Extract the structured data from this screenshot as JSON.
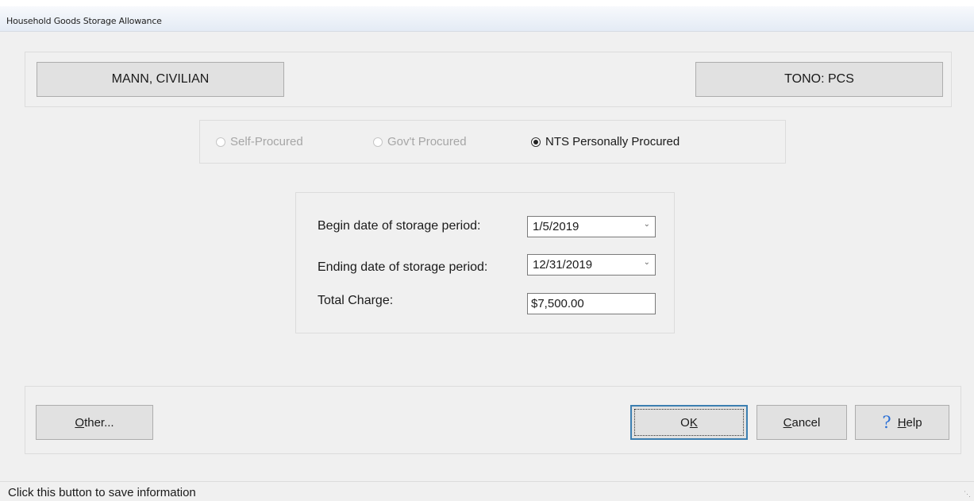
{
  "window": {
    "title": "Household Goods Storage Allowance"
  },
  "header": {
    "member_name": "MANN, CIVILIAN",
    "order_info": "TONO: PCS"
  },
  "procurement": {
    "options": [
      {
        "label": "Self-Procured",
        "selected": false,
        "enabled": false
      },
      {
        "label": "Gov't Procured",
        "selected": false,
        "enabled": false
      },
      {
        "label": "NTS Personally Procured",
        "selected": true,
        "enabled": true
      }
    ]
  },
  "storage": {
    "begin_label": "Begin date of storage period:",
    "begin_value": "1/5/2019",
    "end_label": "Ending date of storage period:",
    "end_value": "12/31/2019",
    "total_label": "Total Charge:",
    "total_value": "$7,500.00"
  },
  "buttons": {
    "other_mn": "O",
    "other_rest": "ther...",
    "ok_pre": "O",
    "ok_mn": "K",
    "cancel_mn": "C",
    "cancel_rest": "ancel",
    "help_mn": "H",
    "help_rest": "elp",
    "help_icon": "?"
  },
  "status": {
    "text": "Click this button to save information"
  }
}
